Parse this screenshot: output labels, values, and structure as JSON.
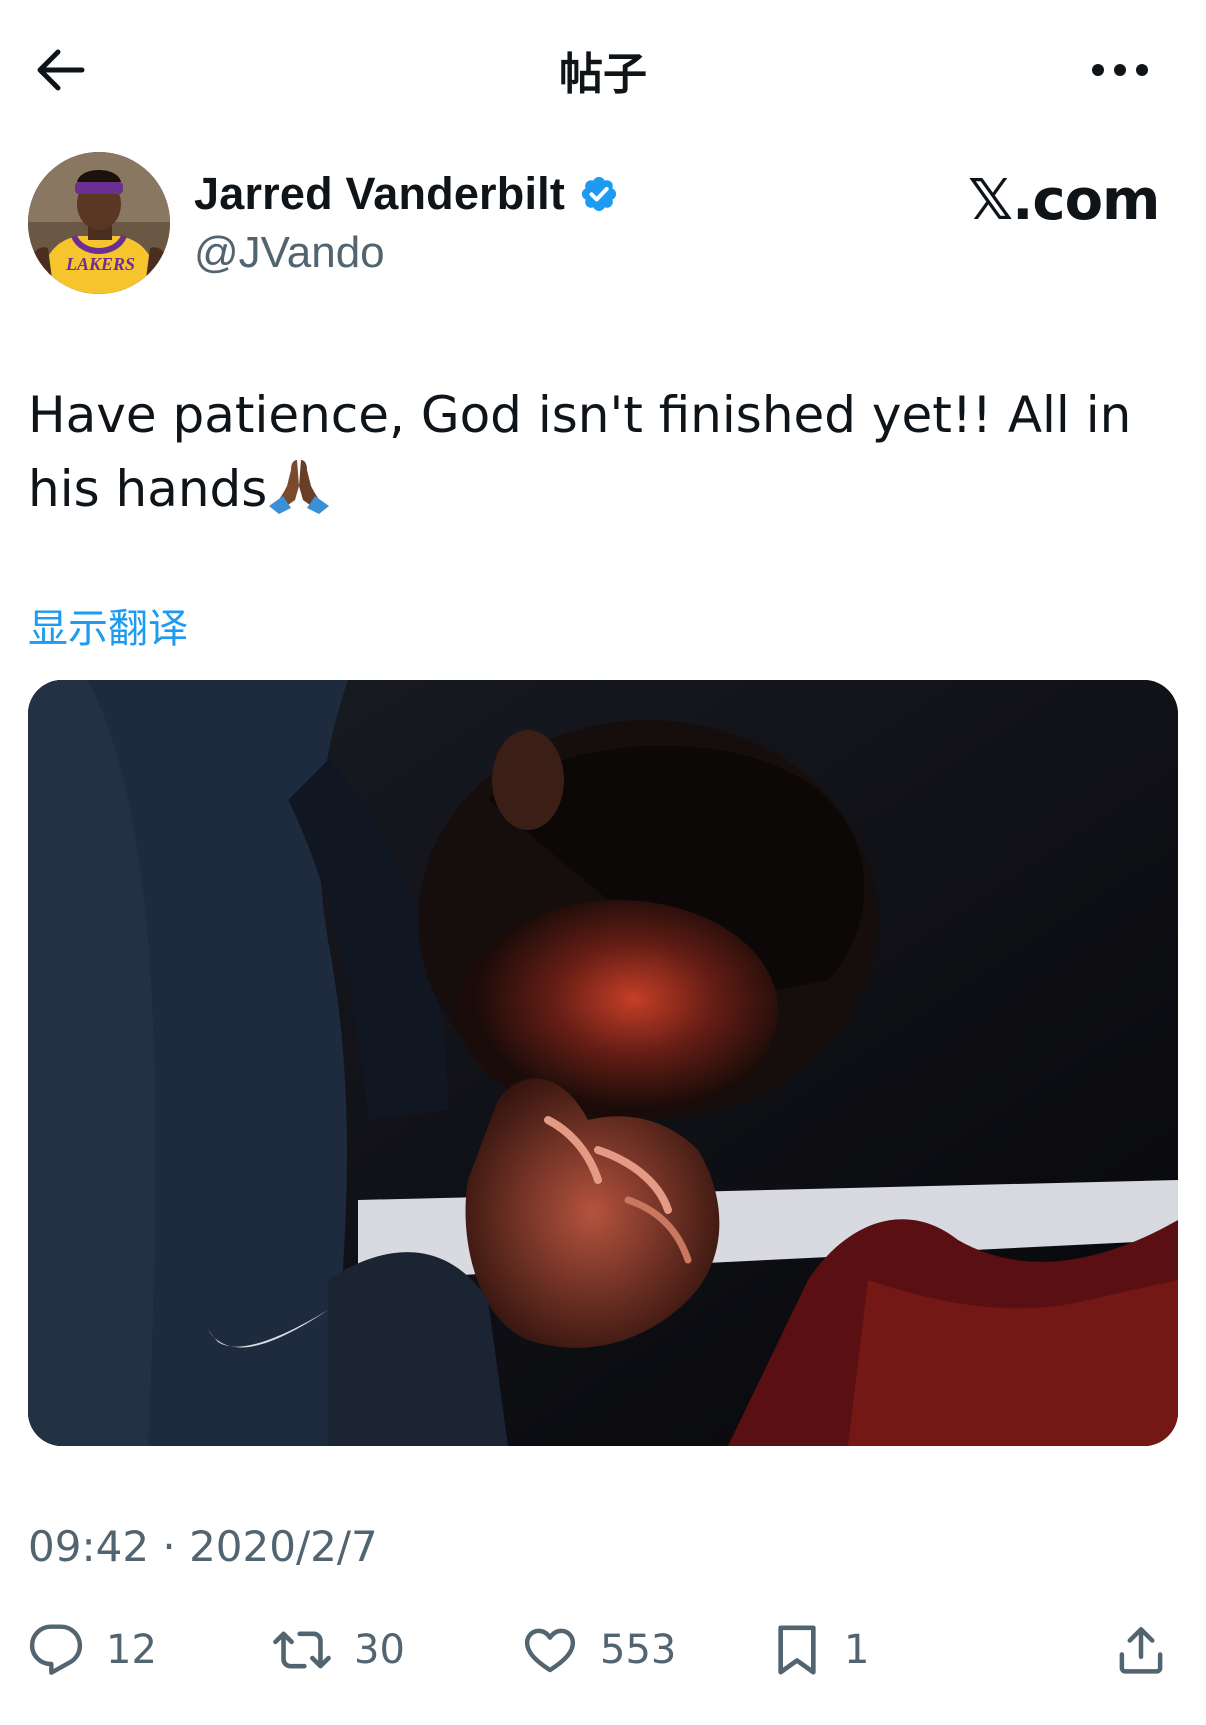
{
  "topbar": {
    "title": "帖子"
  },
  "author": {
    "name": "Jarred Vanderbilt",
    "handle": "@JVando",
    "verified": true,
    "avatar_jersey_text": "LAKERS"
  },
  "watermark": "𝕏.com",
  "tweet": {
    "text": "Have patience, God isn't finished yet!! All in his hands",
    "emoji": "🙏🏾",
    "translate_label": "显示翻译",
    "timestamp": "09:42 · 2020/2/7"
  },
  "actions": {
    "replies": "12",
    "reposts": "30",
    "likes": "553",
    "bookmarks": "1"
  },
  "colors": {
    "link": "#1d9bf0",
    "muted": "#536471",
    "verified": "#1d9bf0"
  },
  "icons": [
    "back-arrow-icon",
    "more-icon",
    "verified-badge-icon",
    "reply-icon",
    "repost-icon",
    "like-icon",
    "bookmark-icon",
    "share-icon"
  ]
}
